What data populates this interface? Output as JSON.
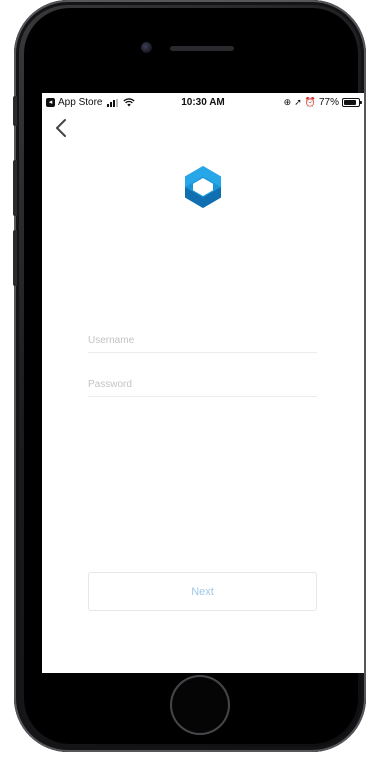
{
  "status_bar": {
    "back_app": "App Store",
    "time": "10:30 AM",
    "battery_percent": "77%",
    "battery_level": 0.77,
    "icons": [
      "signal-icon",
      "wifi-icon",
      "location-lock-icon",
      "location-arrow-icon",
      "alarm-icon",
      "battery-icon"
    ]
  },
  "nav": {
    "back_icon": "chevron-left-icon"
  },
  "brand": {
    "logo_icon": "hexagon-logo-icon",
    "logo_color": "#1a96d8",
    "logo_color_dark": "#0f6fb0"
  },
  "login_form": {
    "username": {
      "value": "",
      "placeholder": "Username"
    },
    "password": {
      "value": "",
      "placeholder": "Password"
    },
    "next_label": "Next"
  },
  "colors": {
    "accent": "#9cc8e6",
    "placeholder": "#c3c3c3",
    "divider": "#ececec"
  }
}
